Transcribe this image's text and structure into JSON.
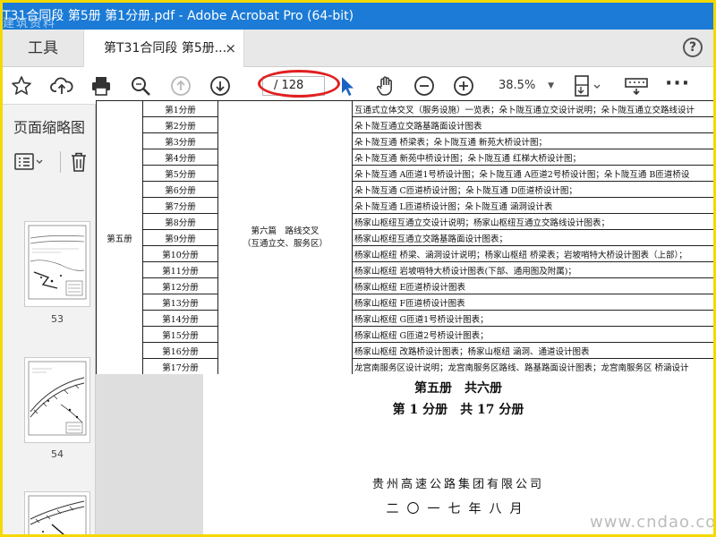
{
  "window": {
    "title": "T31合同段 第5册 第1分册.pdf - Adobe Acrobat Pro (64-bit)",
    "corner_watermark": "建筑资料"
  },
  "tabs": {
    "tools_label": "工具",
    "doc_label": "第T31合同段 第5册...",
    "close_glyph": "×",
    "help_glyph": "?"
  },
  "toolbar": {
    "page_value": "/ 128",
    "zoom_value": "38.5%",
    "zoom_arrow": "▼",
    "more_glyph": "···",
    "annotation_color": "#e02020"
  },
  "sidebar": {
    "title": "页面缩略图",
    "thumbnails": [
      {
        "page": "53"
      },
      {
        "page": "54"
      },
      {
        "page": ""
      }
    ]
  },
  "table": {
    "volume_label": "第五册",
    "chapter_label": "第六篇　路线交叉\n（互通立交、服务区）",
    "rows": [
      {
        "sub": "第1分册",
        "desc": "互通式立体交叉（服务设施）一览表；朵卜陇互通立交设计说明；朵卜陇互通立交路线设计"
      },
      {
        "sub": "第2分册",
        "desc": "朵卜陇互通立交路基路面设计图表"
      },
      {
        "sub": "第3分册",
        "desc": "朵卜陇互通  桥梁表；朵卜陇互通 新苑大桥设计图；"
      },
      {
        "sub": "第4分册",
        "desc": "朵卜陇互通 新苑中桥设计图；朵卜陇互通 红梯大桥设计图；"
      },
      {
        "sub": "第5分册",
        "desc": "朵卜陇互通  A匝道1号桥设计图；朵卜陇互通 A匝道2号桥设计图；朵卜陇互通 B匝道桥设"
      },
      {
        "sub": "第6分册",
        "desc": "朵卜陇互通 C匝道桥设计图；朵卜陇互通 D匝道桥设计图；"
      },
      {
        "sub": "第7分册",
        "desc": "朵卜陇互通 L匝道桥设计图；朵卜陇互通 涵洞设计表"
      },
      {
        "sub": "第8分册",
        "desc": "杨家山枢纽互通立交设计说明；杨家山枢纽互通立交路线设计图表；"
      },
      {
        "sub": "第9分册",
        "desc": "杨家山枢纽互通立交路基路面设计图表；"
      },
      {
        "sub": "第10分册",
        "desc": "杨家山枢纽 桥梁、涵洞设计说明；杨家山枢纽 桥梁表；岩坡哨特大桥设计图表（上部）；"
      },
      {
        "sub": "第11分册",
        "desc": "杨家山枢纽 岩坡哨特大桥设计图表(下部、通用图及附属)；"
      },
      {
        "sub": "第12分册",
        "desc": "杨家山枢纽 E匝道桥设计图表"
      },
      {
        "sub": "第13分册",
        "desc": "杨家山枢纽 F匝道桥设计图表"
      },
      {
        "sub": "第14分册",
        "desc": "杨家山枢纽 G匝道1号桥设计图表；"
      },
      {
        "sub": "第15分册",
        "desc": "杨家山枢纽 G匝道2号桥设计图表；"
      },
      {
        "sub": "第16分册",
        "desc": "杨家山枢纽 改路桥设计图表；杨家山枢纽 涵洞、通道设计图表"
      },
      {
        "sub": "第17分册",
        "desc": "龙宫南服务区设计说明；龙宫南服务区路线、路基路面设计图表；龙宫南服务区  桥涵设计"
      }
    ]
  },
  "page": {
    "volume_line": "第五册　共六册",
    "subvolume_line": "第 1 分册　共 17 分册",
    "org_line": "贵州高速公路集团有限公司",
    "date_line": "二〇一七年八月"
  },
  "site_watermark": "www.cndao.com"
}
